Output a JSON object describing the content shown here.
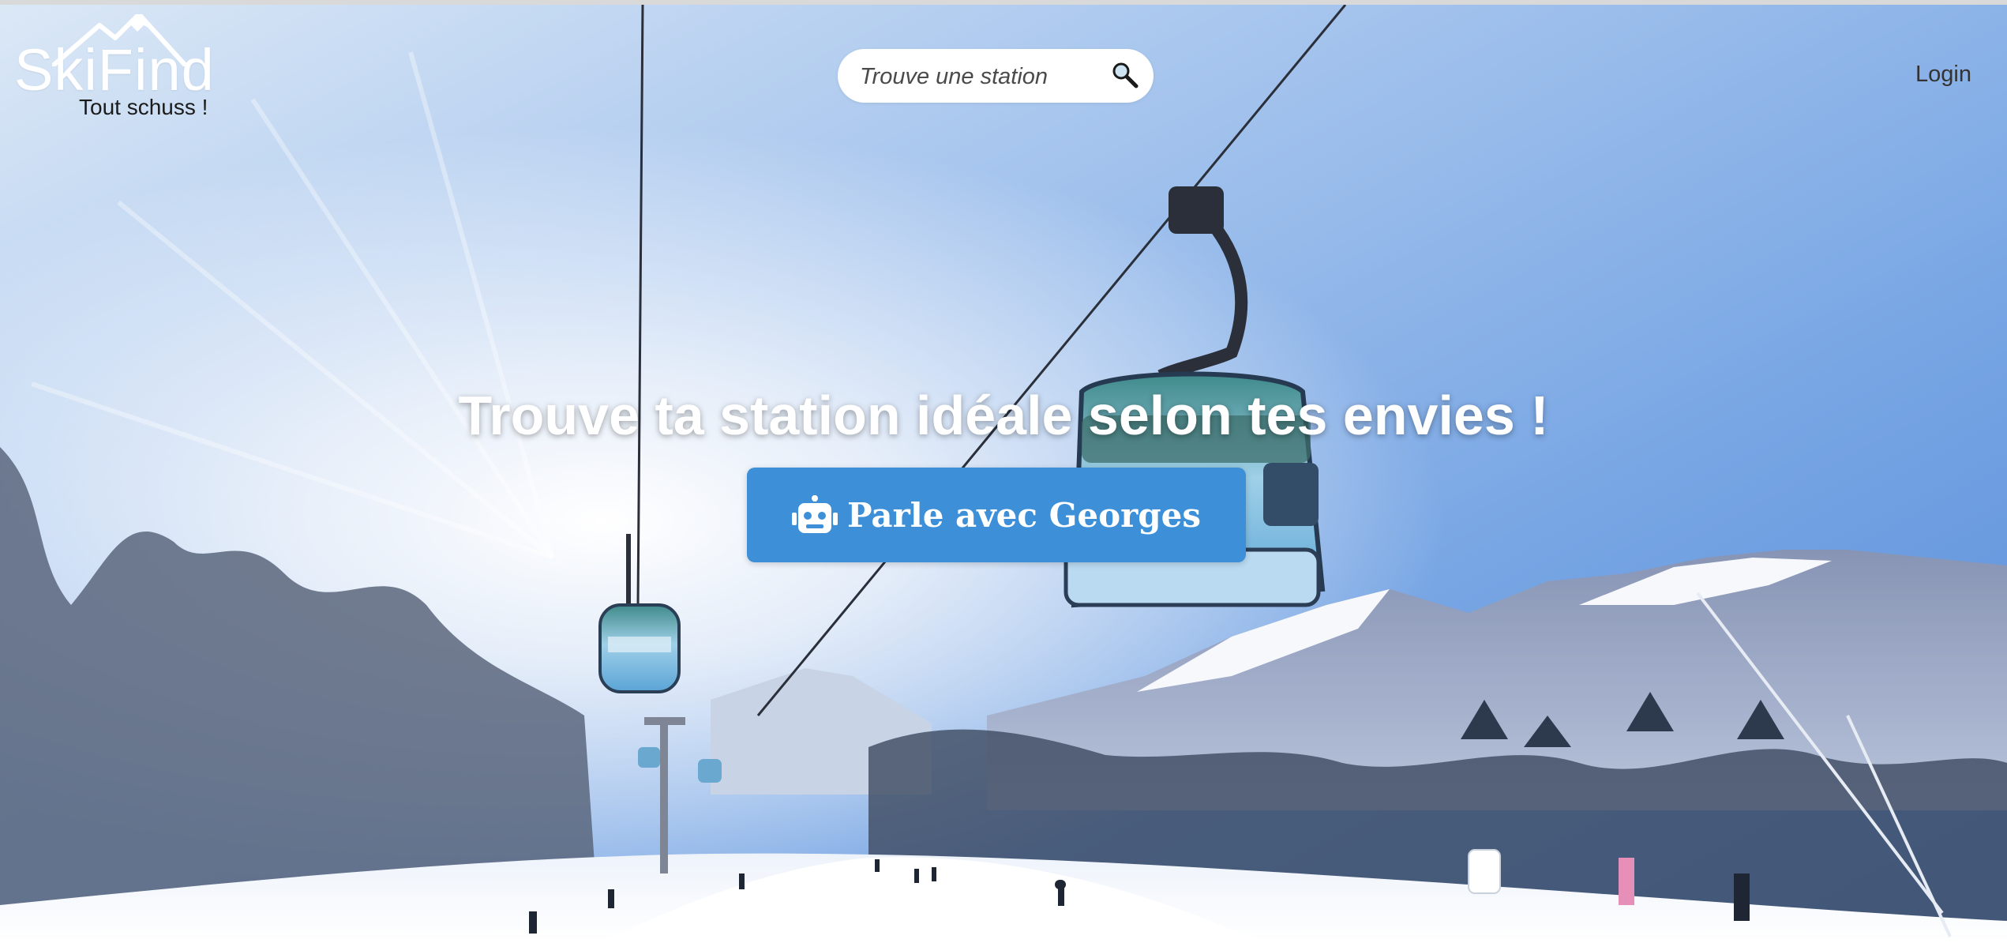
{
  "header": {
    "logo_text": "SkiFind",
    "tagline": "Tout schuss !",
    "search_placeholder": "Trouve une station",
    "login_label": "Login"
  },
  "hero": {
    "title": "Trouve ta station idéale selon tes envies !",
    "cta_label": "Parle avec Georges",
    "cta_icon": "robot-icon"
  },
  "colors": {
    "cta_background": "#3d90d8",
    "sky_top": "#5d92dc",
    "text_white": "#ffffff"
  }
}
